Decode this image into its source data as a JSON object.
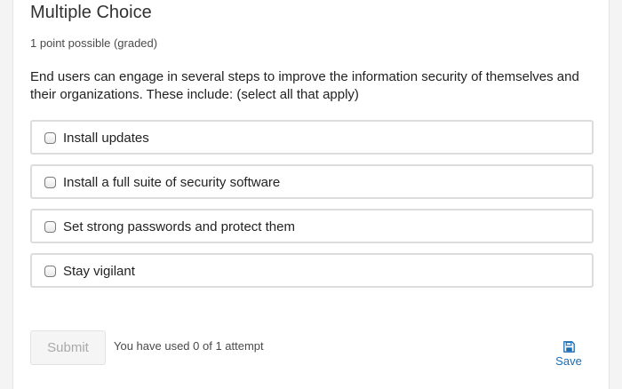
{
  "problem": {
    "title": "Multiple Choice",
    "points": "1 point possible (graded)",
    "prompt": "End users can engage in several steps to improve the information security of themselves and their organizations. These include: (select all that apply)"
  },
  "choices": [
    {
      "label": "Install updates",
      "checked": false
    },
    {
      "label": "Install a full suite of security software",
      "checked": false
    },
    {
      "label": "Set strong passwords and protect them",
      "checked": false
    },
    {
      "label": "Stay vigilant",
      "checked": false
    }
  ],
  "actions": {
    "submit_label": "Submit",
    "submit_enabled": false,
    "attempts_text": "You have used 0 of 1 attempt",
    "save_label": "Save",
    "save_icon": "floppy-disk-icon",
    "accent_color": "#1a6db3"
  }
}
